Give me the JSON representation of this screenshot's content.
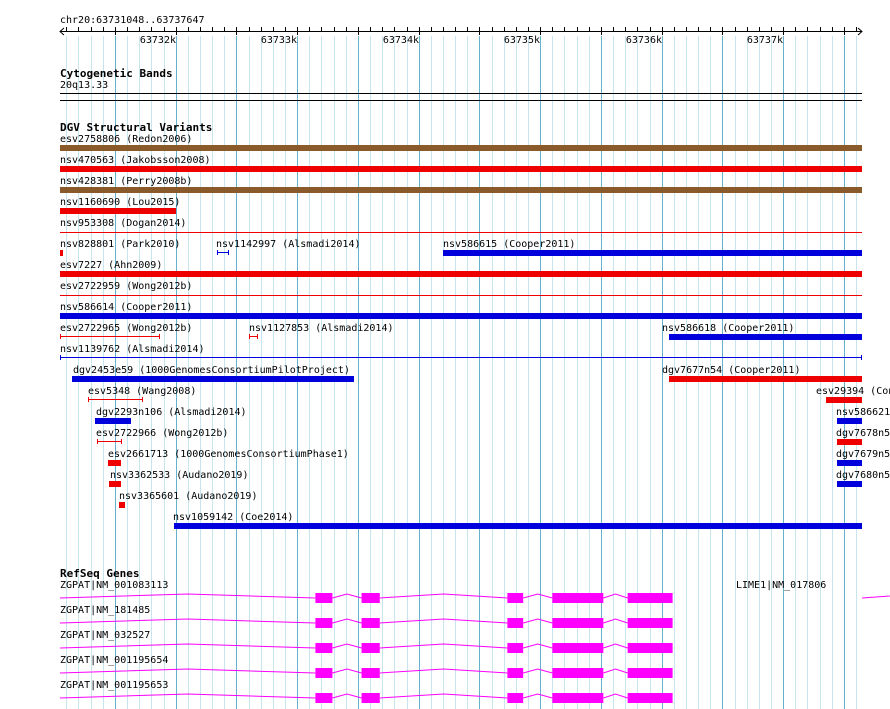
{
  "ruler": {
    "location": "chr20:63731048..63737647",
    "start": 63731048,
    "end": 63737647,
    "ticks": [
      {
        "pos": 63732000,
        "label": "63732k"
      },
      {
        "pos": 63733000,
        "label": "63733k"
      },
      {
        "pos": 63734000,
        "label": "63734k"
      },
      {
        "pos": 63735000,
        "label": "63735k"
      },
      {
        "pos": 63736000,
        "label": "63736k"
      },
      {
        "pos": 63737000,
        "label": "63737k"
      }
    ]
  },
  "colors": {
    "brown": "#8b5a2b",
    "red": "#ee0000",
    "blue": "#0000dd",
    "magenta": "#ff00ff",
    "grid_major": "#66b2cc",
    "grid_minor": "#c6e5ef"
  },
  "cytoband_track": {
    "title": "Cytogenetic Bands",
    "band": "20q13.33"
  },
  "dgv_track": {
    "title": "DGV Structural Variants",
    "features": [
      {
        "label": "esv2758806 (Redon2006)",
        "color": "brown",
        "style": "thick",
        "start": 63731048,
        "end": 63737647
      },
      {
        "label": "nsv470563 (Jakobsson2008)",
        "color": "red",
        "style": "thick",
        "start": 63731048,
        "end": 63737647
      },
      {
        "label": "nsv428381 (Perry2008b)",
        "color": "brown",
        "style": "thick",
        "start": 63731048,
        "end": 63737647
      },
      {
        "label": "nsv1160690 (Lou2015)",
        "color": "red",
        "style": "thick",
        "start": 63731048,
        "end": 63732000
      },
      {
        "label": "nsv953308 (Dogan2014)",
        "color": "red",
        "style": "thin",
        "start": 63731048,
        "end": 63737647
      },
      {
        "label": "nsv828801 (Park2010)",
        "color": "red",
        "style": "thick",
        "start": 63731048,
        "end": 63731070
      },
      {
        "label": "nsv1142997 (Alsmadi2014)",
        "color": "blue",
        "style": "ibar",
        "start": 63732340,
        "end": 63732440
      },
      {
        "label": "nsv586615 (Cooper2011)",
        "color": "blue",
        "style": "thick",
        "start": 63734200,
        "end": 63737647
      },
      {
        "label": "esv7227 (Ahn2009)",
        "color": "red",
        "style": "thick",
        "start": 63731048,
        "end": 63737647
      },
      {
        "label": "esv2722959 (Wong2012b)",
        "color": "red",
        "style": "thin",
        "start": 63731048,
        "end": 63737647
      },
      {
        "label": "nsv586614 (Cooper2011)",
        "color": "blue",
        "style": "thick",
        "start": 63731048,
        "end": 63737647
      },
      {
        "label": "esv2722965 (Wong2012b)",
        "color": "red",
        "style": "ibar",
        "start": 63731048,
        "end": 63731870
      },
      {
        "label": "nsv1127853 (Alsmadi2014)",
        "color": "red",
        "style": "ibar",
        "start": 63732600,
        "end": 63732680
      },
      {
        "label": "nsv586618 (Cooper2011)",
        "color": "blue",
        "style": "thick",
        "start": 63736060,
        "end": 63737647
      },
      {
        "label": "nsv1139762 (Alsmadi2014)",
        "color": "blue",
        "style": "ibar",
        "start": 63731048,
        "end": 63737647
      },
      {
        "label": "dgv2453e59 (1000GenomesConsortiumPilotProject)",
        "color": "blue",
        "style": "thick",
        "start": 63731150,
        "end": 63733470
      },
      {
        "label": "dgv7677n54 (Cooper2011)",
        "color": "red",
        "style": "thick",
        "start": 63736060,
        "end": 63737647
      },
      {
        "label": "esv5348 (Wang2008)",
        "color": "red",
        "style": "ibar",
        "start": 63731280,
        "end": 63731730
      },
      {
        "label": "esv29394 (Con",
        "color": "red",
        "style": "thick",
        "start": 63737350,
        "end": 63737647
      },
      {
        "label": "dgv2293n106 (Alsmadi2014)",
        "color": "blue",
        "style": "thick",
        "start": 63731340,
        "end": 63731630
      },
      {
        "label": "nsv586621",
        "color": "blue",
        "style": "thick",
        "start": 63737440,
        "end": 63737647
      },
      {
        "label": "esv2722966 (Wong2012b)",
        "color": "red",
        "style": "ibar",
        "start": 63731350,
        "end": 63731560
      },
      {
        "label": "dgv7678n5",
        "color": "red",
        "style": "thick",
        "start": 63737440,
        "end": 63737647
      },
      {
        "label": "esv2661713 (1000GenomesConsortiumPhase1)",
        "color": "red",
        "style": "thick",
        "start": 63731440,
        "end": 63731550
      },
      {
        "label": "dgv7679n5",
        "color": "blue",
        "style": "thick",
        "start": 63737440,
        "end": 63737647
      },
      {
        "label": "nsv3362533 (Audano2019)",
        "color": "red",
        "style": "thick",
        "start": 63731450,
        "end": 63731550
      },
      {
        "label": "dgv7680n5",
        "color": "blue",
        "style": "thick",
        "start": 63737440,
        "end": 63737647
      },
      {
        "label": "nsv3365601 (Audano2019)",
        "color": "red",
        "style": "thick",
        "start": 63731530,
        "end": 63731580
      },
      {
        "label": "nsv1059142 (Coe2014)",
        "color": "blue",
        "style": "thick",
        "start": 63731990,
        "end": 63737647
      }
    ]
  },
  "refseq_track": {
    "title": "RefSeq Genes",
    "genes": [
      {
        "label": "ZGPAT|NM_001083113"
      },
      {
        "label": "LIME1|NM_017806"
      },
      {
        "label": "ZGPAT|NM_181485"
      },
      {
        "label": "ZGPAT|NM_032527"
      },
      {
        "label": "ZGPAT|NM_001195654"
      },
      {
        "label": "ZGPAT|NM_001195653"
      }
    ],
    "zgpat_exons": [
      [
        63731048,
        63731048
      ],
      [
        63733150,
        63733290
      ],
      [
        63733530,
        63733680
      ],
      [
        63734730,
        63734860
      ],
      [
        63735100,
        63735520
      ],
      [
        63735720,
        63736090
      ]
    ],
    "zgpat_end": 63736090,
    "lime1_exons": [
      [
        63737670,
        63737760
      ],
      [
        63738580,
        63738700
      ]
    ]
  }
}
